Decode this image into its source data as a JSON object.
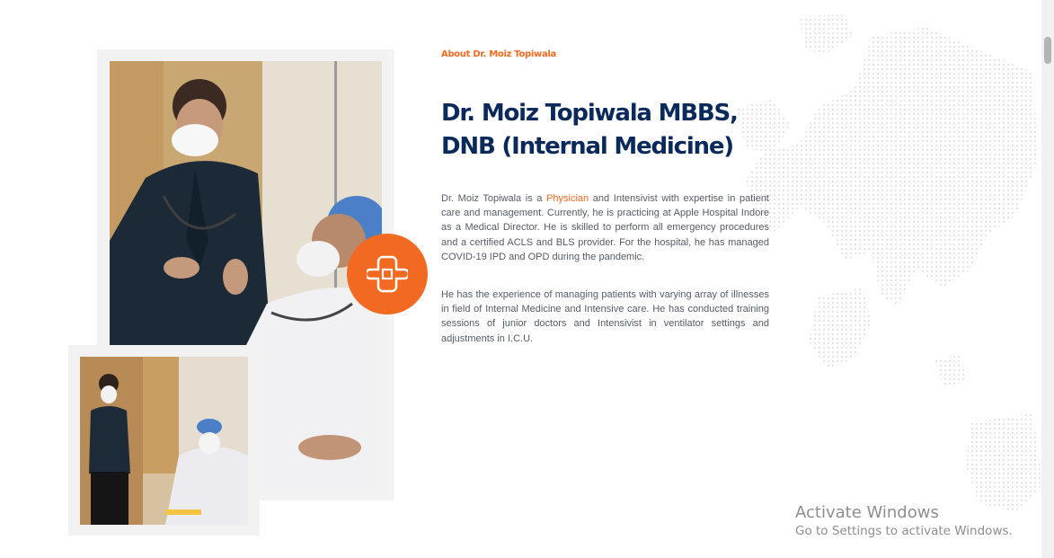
{
  "about": {
    "eyebrow": "About Dr. Moiz Topiwala",
    "title_line1": "Dr. Moiz Topiwala MBBS,",
    "title_line2": "DNB (Internal Medicine)",
    "para1_before": "Dr. Moiz Topiwala is a ",
    "para1_link": "Physician",
    "para1_after": " and Intensivist with expertise in patient care and management. Currently, he is practicing at Apple Hospital Indore as a Medical Director. He is skilled to perform all emergency procedures and a certified ACLS and BLS provider. For the hospital, he has managed COVID-19 IPD and OPD during the pandemic.",
    "para2": "He has the experience of managing patients with varying array of illnesses in field of Internal Medicine and Intensive care. He has conducted training sessions of junior doctors and Intensivist in ventilator settings and adjustments in I.C.U."
  },
  "watermark": {
    "title": "Activate Windows",
    "subtitle": "Go to Settings to activate Windows."
  },
  "icons": {
    "badge": "medical-cross-icon"
  },
  "colors": {
    "accent": "#f26a21",
    "heading": "#0b2a5b",
    "body": "#555b66"
  }
}
